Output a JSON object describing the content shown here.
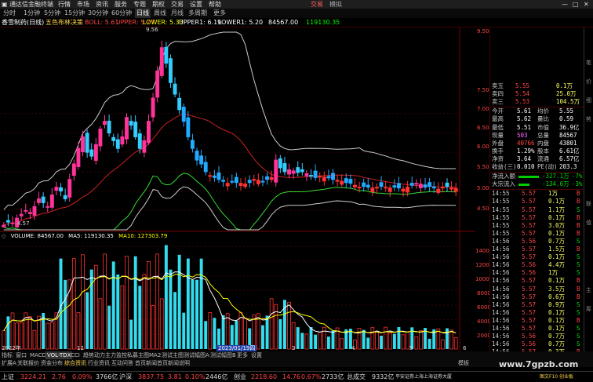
{
  "titlebar": {
    "app_title": "通达信金融终端",
    "menu": [
      "行情",
      "市场",
      "资讯",
      "服务",
      "专题",
      "期权",
      "交易",
      "设置",
      "帮助"
    ],
    "trade_label": "交易",
    "login_label": "模拟"
  },
  "menubar": {
    "items": [
      "分时",
      "1分钟",
      "5分钟",
      "15分钟",
      "30分钟",
      "60分钟",
      "日线",
      "周线",
      "月线",
      "多周期",
      "更多"
    ],
    "active": "日线"
  },
  "legend_main": {
    "stock": "香雪制药(日线)",
    "indicator": "五色布林决策",
    "items": [
      {
        "text": "BOLL: 5.61",
        "color": "#ff4444"
      },
      {
        "text": "UPPER: 5.77",
        "color": "#ff4444"
      },
      {
        "text": "LOWER: 5.33",
        "color": "#ffff00"
      },
      {
        "text": "UPPER1: 6.19",
        "color": "#ffffff"
      },
      {
        "text": "LOWER1: 5.20",
        "color": "#ffffff"
      },
      {
        "text": "84567.00",
        "color": "#ffffff"
      },
      {
        "text": "119130.35",
        "color": "#00ff00"
      }
    ],
    "peak_label": "9.56",
    "low_label": "4.57"
  },
  "legend_vol": {
    "items": [
      {
        "text": "VOLUME: 84567.00",
        "color": "#ffffff"
      },
      {
        "text": "MA5: 119130.35",
        "color": "#ffffff"
      },
      {
        "text": "MA10: 127303.79",
        "color": "#ffff00"
      }
    ]
  },
  "price_axis": [
    "9.50",
    "7.50",
    "7.00",
    "6.50",
    "6.00",
    "5.50",
    "5.00",
    "4.50"
  ],
  "vol_axis": [
    "14000",
    "12000",
    "10000",
    "8000",
    "6000",
    "4000",
    "2000"
  ],
  "date_axis": [
    "2022年",
    "12",
    "2023/01/19四",
    "3",
    "4",
    "5",
    "6"
  ],
  "quote": {
    "asks": [
      {
        "label": "卖五",
        "price": "5.55",
        "vol": "0.1万"
      },
      {
        "label": "卖四",
        "price": "5.54",
        "vol": "25.0万"
      },
      {
        "label": "卖三",
        "price": "5.53",
        "vol": "104.5万"
      }
    ],
    "stats": [
      {
        "l1": "今开",
        "v1": "5.61",
        "l2": "均价",
        "v2": "5.55"
      },
      {
        "l1": "最高",
        "v1": "5.62",
        "l2": "量比",
        "v2": "0.59"
      },
      {
        "l1": "最低",
        "v1": "5.51",
        "l2": "市值",
        "v2": "36.9亿"
      },
      {
        "l1": "现量",
        "v1": "503",
        "l2": "总量",
        "v2": "84567"
      },
      {
        "l1": "外盘",
        "v1": "40766",
        "l2": "内盘",
        "v2": "43801"
      },
      {
        "l1": "换手",
        "v1": "1.29%",
        "l2": "股本",
        "v2": "6.61亿"
      },
      {
        "l1": "净资",
        "v1": "3.64",
        "l2": "流通",
        "v2": "6.57亿"
      },
      {
        "l1": "收益(三)",
        "v1": "0.010",
        "l2": "PE(动)",
        "v2": "203.3"
      }
    ],
    "flows": [
      {
        "label": "净流入额",
        "value": "-327.1万",
        "pct": "-7%"
      },
      {
        "label": "大宗流入",
        "value": "-134.6万",
        "pct": "-3%"
      }
    ],
    "ticks": [
      {
        "time": "14:55",
        "price": "5.57",
        "vol": "1万",
        "side": "B"
      },
      {
        "time": "14:55",
        "price": "5.57",
        "vol": "0.1万",
        "side": "B"
      },
      {
        "time": "14:55",
        "price": "5.57",
        "vol": "1.1万",
        "side": "S"
      },
      {
        "time": "14:55",
        "price": "5.57",
        "vol": "0.1万",
        "side": "B"
      },
      {
        "time": "14:55",
        "price": "5.57",
        "vol": "3.0万",
        "side": "B"
      },
      {
        "time": "14:55",
        "price": "5.57",
        "vol": "0.1万",
        "side": "B"
      },
      {
        "time": "14:56",
        "price": "5.56",
        "vol": "0.7万",
        "side": "S"
      },
      {
        "time": "14:56",
        "price": "5.57",
        "vol": "1.5万",
        "side": "B"
      },
      {
        "time": "14:56",
        "price": "5.57",
        "vol": "0.1万",
        "side": "S"
      },
      {
        "time": "14:56",
        "price": "5.56",
        "vol": "4.4万",
        "side": "S"
      },
      {
        "time": "14:56",
        "price": "5.56",
        "vol": "1万",
        "side": "S"
      },
      {
        "time": "14:56",
        "price": "5.57",
        "vol": "0.1万",
        "side": "B"
      },
      {
        "time": "14:56",
        "price": "5.57",
        "vol": "3.5万",
        "side": "B"
      },
      {
        "time": "14:56",
        "price": "5.57",
        "vol": "0.6万",
        "side": "B"
      },
      {
        "time": "14:56",
        "price": "5.57",
        "vol": "0.9万",
        "side": "S"
      },
      {
        "time": "14:56",
        "price": "5.57",
        "vol": "0.1万",
        "side": "S"
      },
      {
        "time": "14:56",
        "price": "5.57",
        "vol": "0.1万",
        "side": "B"
      },
      {
        "time": "14:56",
        "price": "5.57",
        "vol": "0.1万",
        "side": "S"
      },
      {
        "time": "14:56",
        "price": "5.56",
        "vol": "0.7万",
        "side": "S"
      },
      {
        "time": "14:56",
        "price": "5.56",
        "vol": "0.7万",
        "side": "S"
      },
      {
        "time": "14:56",
        "price": "5.57",
        "vol": "0.3万",
        "side": "B"
      }
    ]
  },
  "sidetabs": [
    "笔",
    "价",
    "细",
    "势",
    "联",
    "值",
    "主",
    "筹"
  ],
  "bottomtabs": {
    "row1": [
      "指标",
      "窗口",
      "MACD",
      "VOL-TDX",
      "CCI",
      "趋势动力",
      "主力监控",
      "私募主图",
      "MA2",
      "测试主图",
      "测试幅图A",
      "测试幅图B",
      "更多",
      "设置"
    ],
    "active": "VOL-TDX",
    "row2": [
      "扩展A",
      "关联报价",
      "资金分布",
      "综合资讯",
      "行业资讯",
      "互动问答",
      "首页新闻",
      "首页新闻说明"
    ],
    "right": "模板"
  },
  "indexbar": [
    {
      "name": "上证",
      "value": "3224.21",
      "chg": "2.76",
      "pct": "0.09%",
      "amt": "3766亿",
      "color": "#ff4444"
    },
    {
      "name": "沪深",
      "value": "3837.75",
      "chg": "3.81",
      "pct": "0.10%",
      "amt": "2446亿",
      "color": "#ff4444"
    },
    {
      "name": "创业",
      "value": "2218.60",
      "chg": "14.76",
      "pct": "0.67%",
      "amt": "2733亿",
      "color": "#ff4444"
    }
  ],
  "indexbar_extra": {
    "total": "总成交",
    "total_val": "9332亿",
    "broker": "平安证券上海上海证券大厦",
    "right": "图文F10 创业板"
  },
  "watermark": "www.7gpzb.com",
  "chart_data": {
    "type": "candlestick",
    "title": "香雪制药(日线)",
    "ylim_price": [
      4.5,
      9.6
    ],
    "annotations": {
      "high": 9.56,
      "low": 4.57
    },
    "closes": [
      4.62,
      4.7,
      4.68,
      4.8,
      4.9,
      5.0,
      4.95,
      5.1,
      5.3,
      5.2,
      5.1,
      5.4,
      5.6,
      5.5,
      5.3,
      5.8,
      6.2,
      6.6,
      6.9,
      6.5,
      6.4,
      6.7,
      7.1,
      7.3,
      7.0,
      6.8,
      6.6,
      6.9,
      7.4,
      7.2,
      6.9,
      6.6,
      6.8,
      7.3,
      7.9,
      8.6,
      9.2,
      8.8,
      8.3,
      8.0,
      7.6,
      7.3,
      6.9,
      6.6,
      6.3,
      6.2,
      6.0,
      5.9,
      5.85,
      5.8,
      5.75,
      5.7,
      5.75,
      5.72,
      5.7,
      5.68,
      5.72,
      5.8,
      5.78,
      5.75,
      5.8,
      5.85,
      6.3,
      6.1,
      6.0,
      6.05,
      6.02,
      5.98,
      6.0,
      5.95,
      5.9,
      5.85,
      5.88,
      5.86,
      5.84,
      5.8,
      5.78,
      5.75,
      5.72,
      5.7,
      5.65,
      5.6,
      5.62,
      5.6,
      5.58,
      5.6,
      5.62,
      5.6,
      5.58,
      5.6,
      5.58,
      5.55,
      5.6,
      5.65,
      5.7,
      5.68,
      5.6,
      5.62,
      5.58,
      5.55,
      5.6,
      5.62,
      5.58,
      5.57
    ],
    "volume_ylim": [
      0,
      15000
    ]
  }
}
